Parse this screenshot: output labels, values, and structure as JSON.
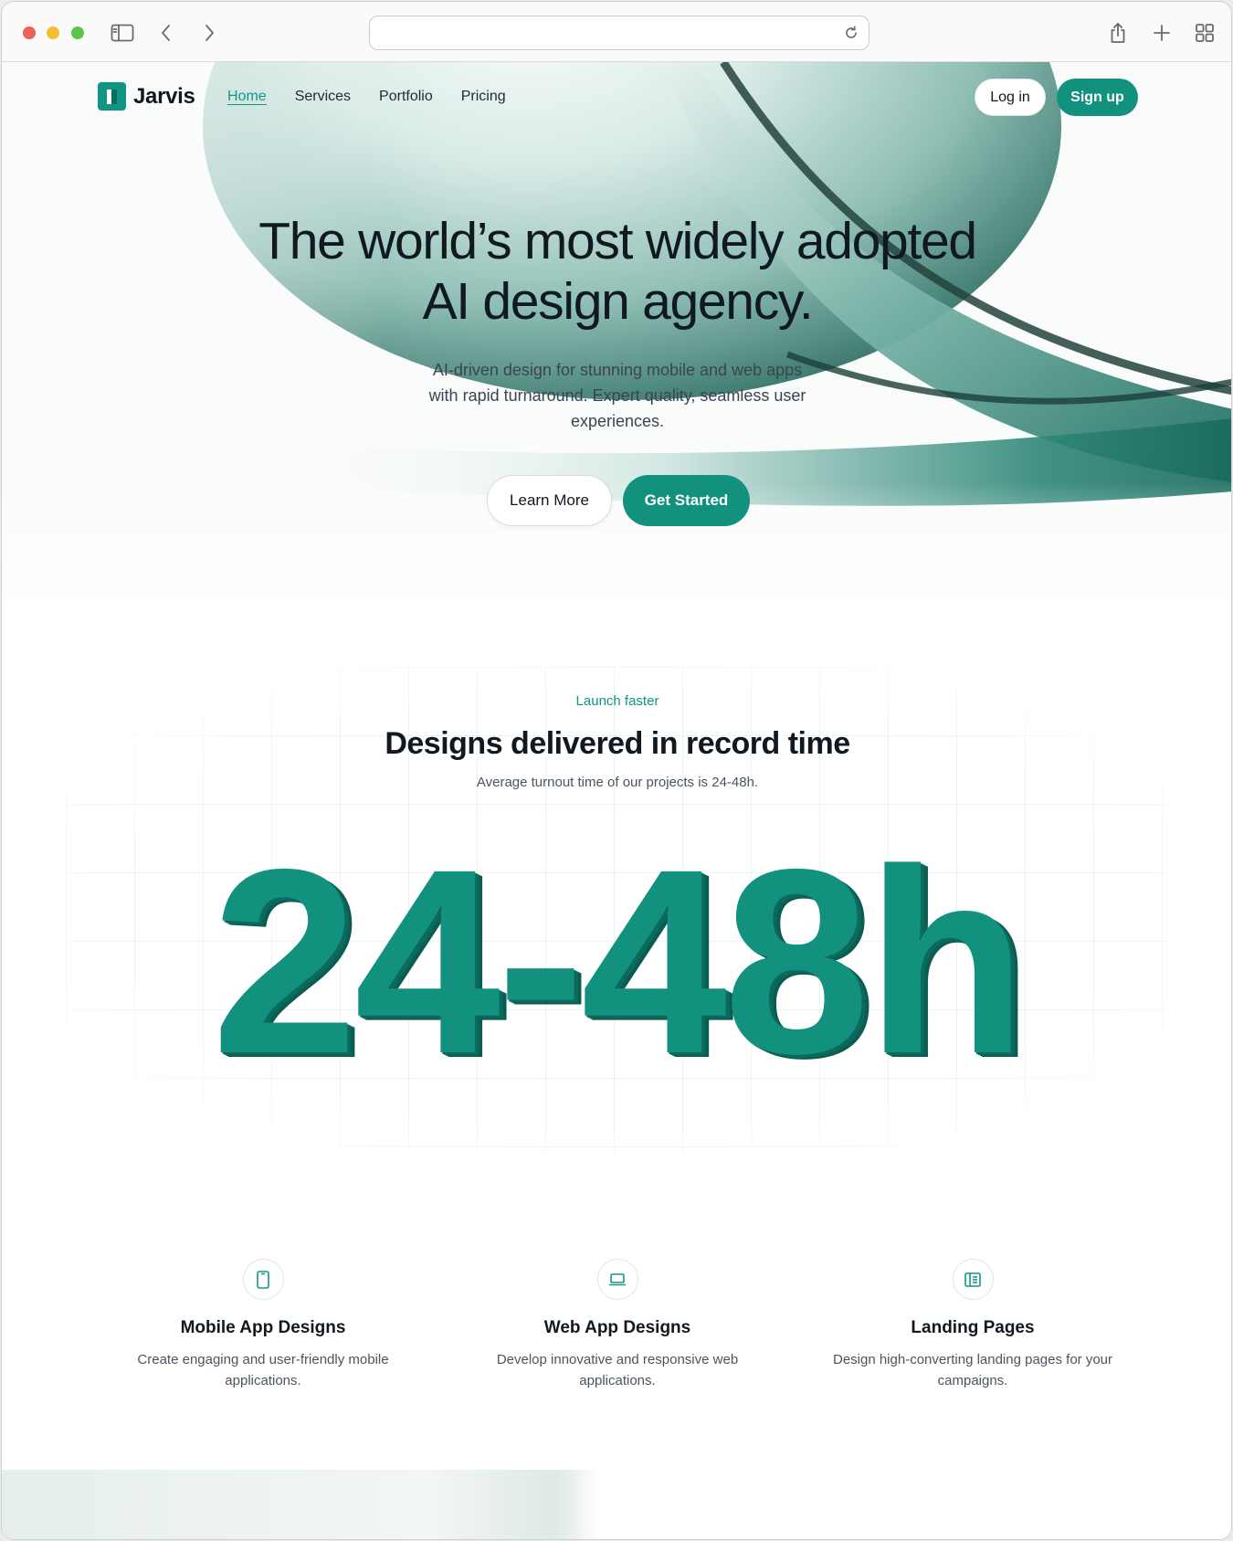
{
  "browser": {
    "url_value": "",
    "url_placeholder": ""
  },
  "nav": {
    "brand": "Jarvis",
    "links": [
      {
        "label": "Home",
        "active": true
      },
      {
        "label": "Services",
        "active": false
      },
      {
        "label": "Portfolio",
        "active": false
      },
      {
        "label": "Pricing",
        "active": false
      }
    ],
    "login_label": "Log in",
    "signup_label": "Sign up"
  },
  "hero": {
    "title_line1": "The world’s most widely adopted",
    "title_line2": "AI design agency.",
    "subtitle": "AI-driven design for stunning mobile and web apps with rapid turnaround. Expert quality, seamless user experiences.",
    "learn_more_label": "Learn More",
    "get_started_label": "Get Started"
  },
  "stats": {
    "eyebrow": "Launch faster",
    "title": "Designs delivered in record time",
    "subtitle": "Average turnout time of our projects is 24-48h.",
    "big_number": "24-48h"
  },
  "features": [
    {
      "icon": "mobile-icon",
      "title": "Mobile App Designs",
      "description": "Create engaging and user-friendly mobile applications."
    },
    {
      "icon": "laptop-icon",
      "title": "Web App Designs",
      "description": "Develop innovative and responsive web applications."
    },
    {
      "icon": "landing-page-icon",
      "title": "Landing Pages",
      "description": "Design high-converting landing pages for your campaigns."
    }
  ],
  "colors": {
    "accent": "#12917f",
    "accent_dark": "#0b6a5d",
    "text": "#101820"
  }
}
